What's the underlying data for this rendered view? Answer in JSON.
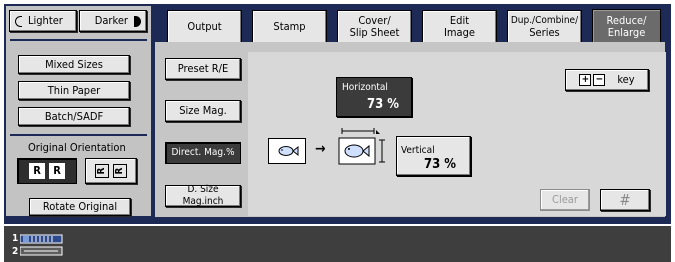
{
  "density": {
    "lighter_label": "Lighter",
    "darker_label": "Darker"
  },
  "left_panel": {
    "mixed_sizes_label": "Mixed Sizes",
    "thin_paper_label": "Thin Paper",
    "batch_sadf_label": "Batch/SADF",
    "original_orientation_label": "Original Orientation",
    "rotate_original_label": "Rotate Original",
    "orientation_glyph": "R"
  },
  "tabs": [
    {
      "line1": "Output",
      "line2": ""
    },
    {
      "line1": "Stamp",
      "line2": ""
    },
    {
      "line1": "Cover/",
      "line2": "Slip Sheet"
    },
    {
      "line1": "Edit",
      "line2": "Image"
    },
    {
      "line1": "Dup./Combine/",
      "line2": "Series"
    },
    {
      "line1": "Reduce/",
      "line2": "Enlarge"
    }
  ],
  "mode_buttons": {
    "preset_label": "Preset R/E",
    "size_mag_label": "Size Mag.",
    "direct_mag_label": "Direct. Mag.%",
    "d_size_mag_label": "D. Size Mag.inch"
  },
  "magnification": {
    "horizontal_caption": "Horizontal",
    "horizontal_value": "73 %",
    "vertical_caption": "Vertical",
    "vertical_value": "73 %",
    "arrow": "→"
  },
  "controls": {
    "plus_glyph": "+",
    "minus_glyph": "−",
    "key_label": "key",
    "clear_label": "Clear",
    "hash_label": "#"
  },
  "status": {
    "tray1": "1",
    "tray2": "2"
  },
  "colors": {
    "frame": "#1d2a55",
    "selected": "#3b3b3b",
    "active_tab": "#6b6b6b"
  }
}
